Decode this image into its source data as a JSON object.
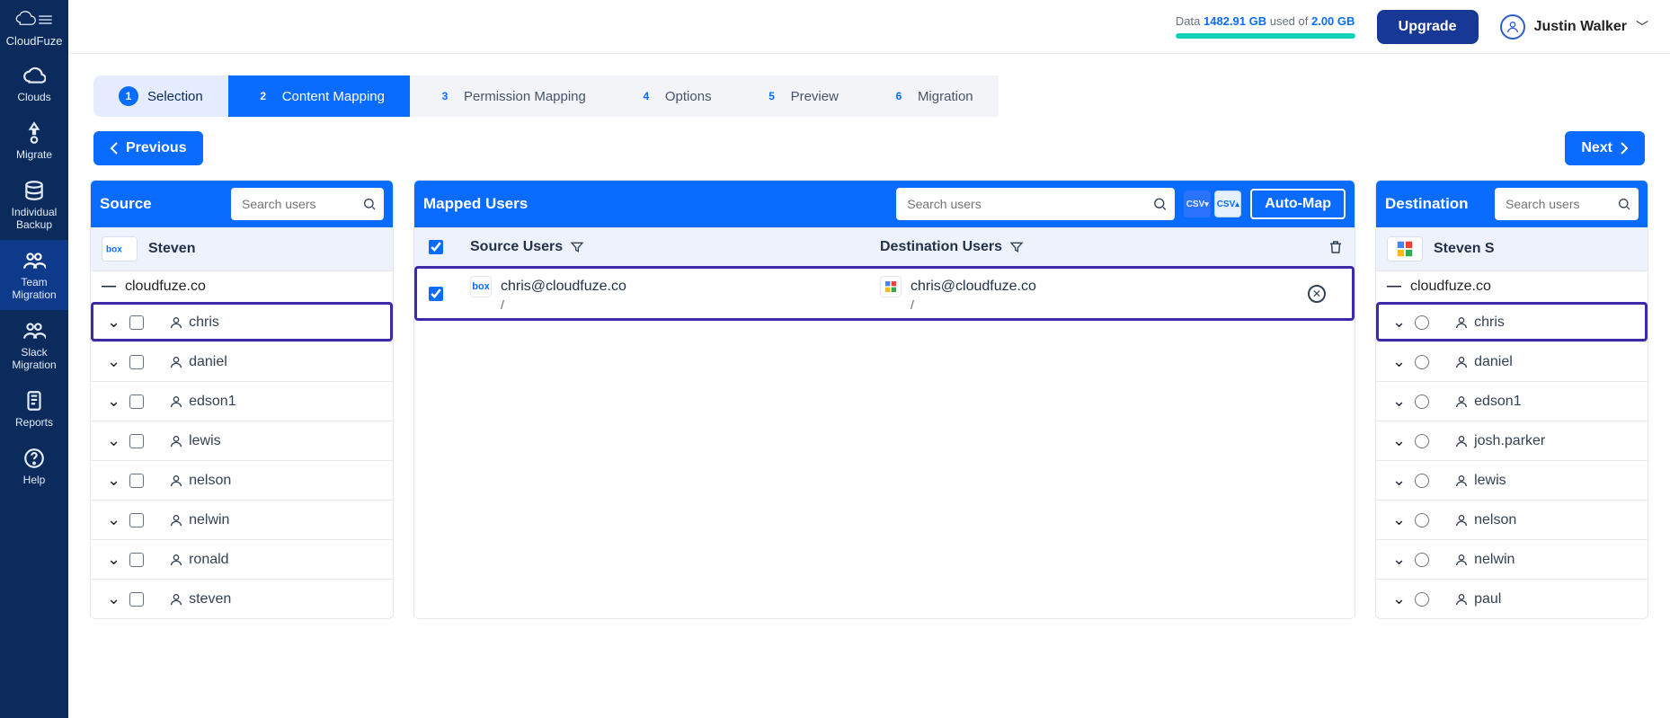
{
  "brand": "CloudFuze",
  "sidebar": {
    "items": [
      {
        "label": "Clouds"
      },
      {
        "label": "Migrate"
      },
      {
        "label": "Individual Backup"
      },
      {
        "label": "Team Migration"
      },
      {
        "label": "Slack Migration"
      },
      {
        "label": "Reports"
      },
      {
        "label": "Help"
      }
    ]
  },
  "topbar": {
    "data_prefix": "Data ",
    "data_used": "1482.91 GB",
    "data_mid": " used of ",
    "data_total": "2.00 GB",
    "upgrade": "Upgrade",
    "user": "Justin Walker",
    "progress_pct": 100
  },
  "stepper": [
    {
      "n": "1",
      "label": "Selection",
      "state": "done"
    },
    {
      "n": "2",
      "label": "Content Mapping",
      "state": "active"
    },
    {
      "n": "3",
      "label": "Permission Mapping",
      "state": "plain"
    },
    {
      "n": "4",
      "label": "Options",
      "state": "plain"
    },
    {
      "n": "5",
      "label": "Preview",
      "state": "plain"
    },
    {
      "n": "6",
      "label": "Migration",
      "state": "plain"
    }
  ],
  "buttons": {
    "prev": "Previous",
    "next": "Next"
  },
  "source": {
    "title": "Source",
    "search_ph": "Search users",
    "owner": "Steven",
    "domain": "cloudfuze.co",
    "users": [
      "chris",
      "daniel",
      "edson1",
      "lewis",
      "nelson",
      "nelwin",
      "ronald",
      "steven"
    ]
  },
  "mapped": {
    "title": "Mapped Users",
    "search_ph": "Search users",
    "auto": "Auto-Map",
    "cols": {
      "src": "Source Users",
      "dst": "Destination Users"
    },
    "row": {
      "src_email": "chris@cloudfuze.co",
      "dst_email": "chris@cloudfuze.co",
      "src_path": "/",
      "dst_path": "/"
    }
  },
  "dest": {
    "title": "Destination",
    "search_ph": "Search users",
    "owner": "Steven S",
    "domain": "cloudfuze.co",
    "users": [
      "chris",
      "daniel",
      "edson1",
      "josh.parker",
      "lewis",
      "nelson",
      "nelwin",
      "paul"
    ]
  }
}
